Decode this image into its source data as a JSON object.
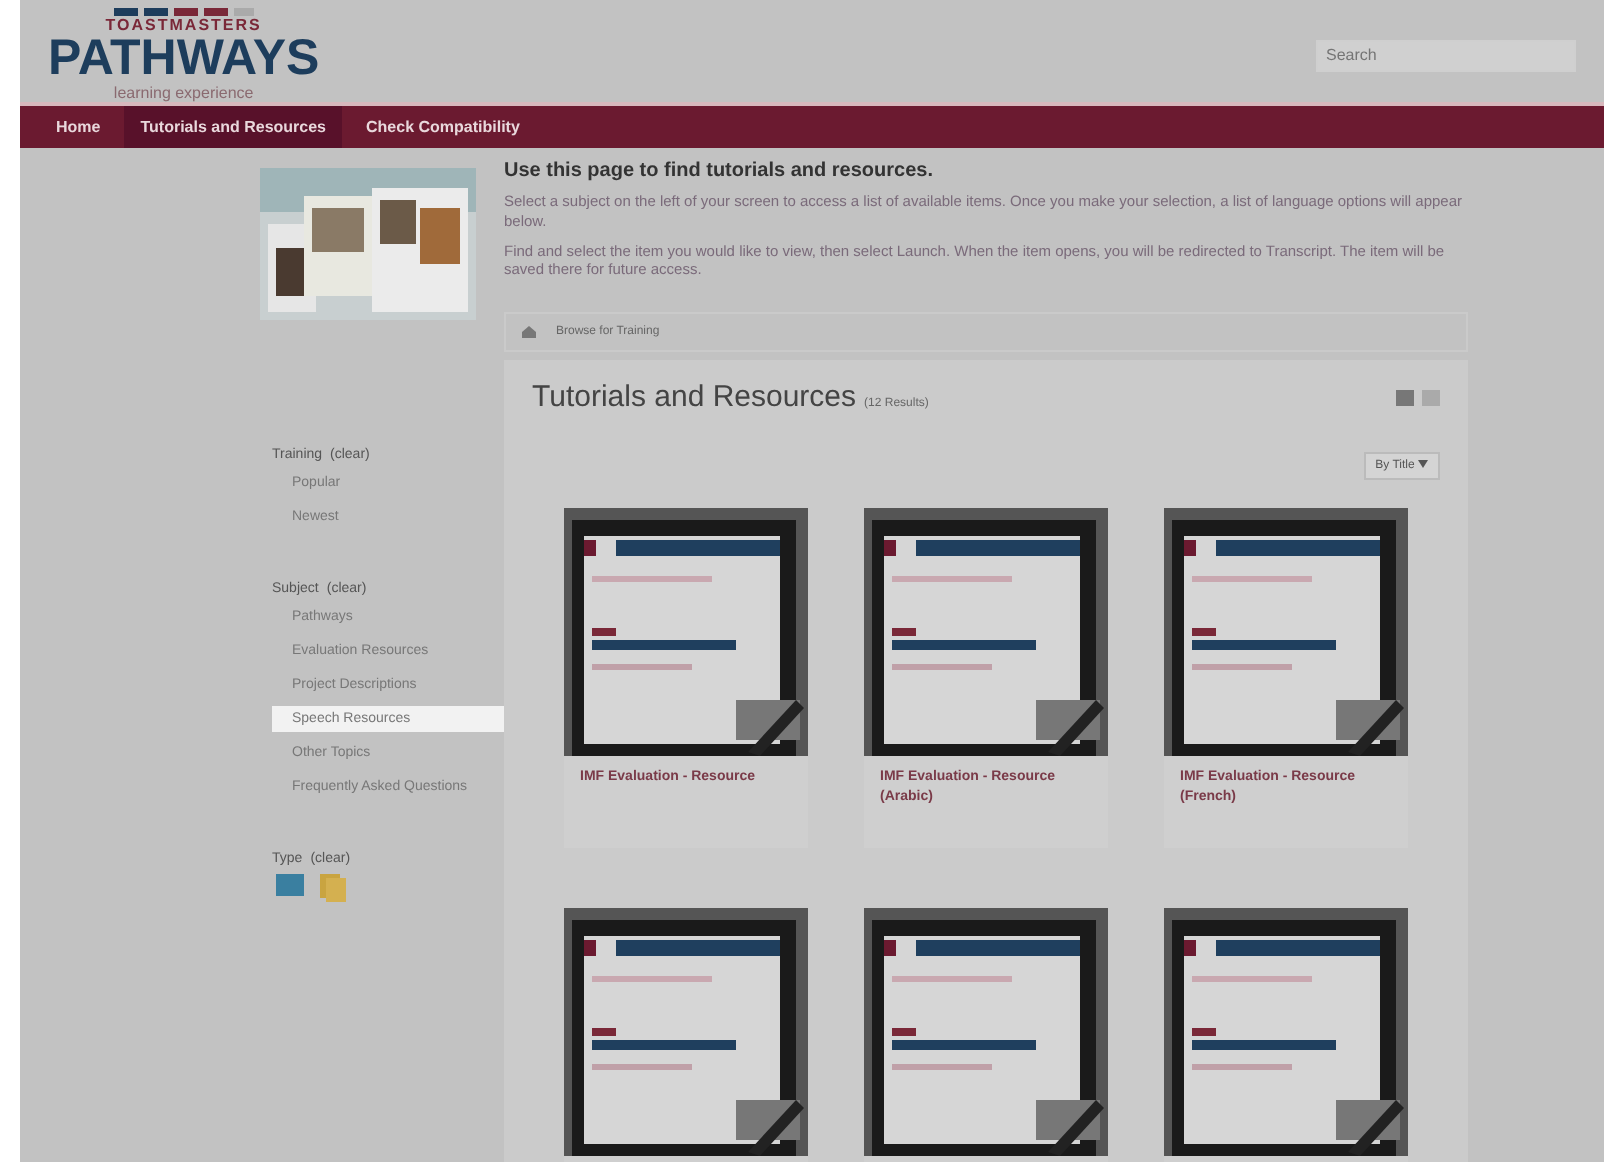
{
  "header": {
    "logo_top": "TOASTMASTERS",
    "logo_main": "PATHWAYS",
    "logo_sub": "learning experience",
    "search": {
      "placeholder": "Search"
    }
  },
  "nav": [
    {
      "label": "Home",
      "selected": false
    },
    {
      "label": "Tutorials and Resources",
      "selected": true
    },
    {
      "label": "Check Compatibility",
      "selected": false
    }
  ],
  "intro": {
    "heading": "Use this page to find tutorials and resources.",
    "paragraphs": [
      "Select a subject on the left of your screen to access a list of available items. Once you make your selection, a list of language options will appear below.",
      "Find and select the item you would like to view, then select Launch. When the item opens, you will be redirected to Transcript. The item will be saved there for future access."
    ]
  },
  "breadcrumb": "Browse for Training",
  "filters": [
    {
      "title": "Training",
      "clear": "(clear)",
      "items": [
        {
          "label": "Popular",
          "selected": false
        },
        {
          "label": "Newest",
          "selected": false
        }
      ]
    },
    {
      "title": "Subject",
      "clear": "(clear)",
      "items": [
        {
          "label": "Pathways",
          "selected": false
        },
        {
          "label": "Evaluation Resources",
          "selected": false
        },
        {
          "label": "Project Descriptions",
          "selected": false
        },
        {
          "label": "Speech Resources",
          "selected": true
        },
        {
          "label": "Other Topics",
          "selected": false
        },
        {
          "label": "Frequently Asked Questions",
          "selected": false
        }
      ]
    },
    {
      "title": "Type",
      "clear": "(clear)",
      "types": [
        {
          "kind": "video"
        },
        {
          "kind": "document"
        }
      ]
    }
  ],
  "results": {
    "title": "Tutorials and Resources",
    "count": "(12 Results)",
    "sort": "By Title",
    "cards": [
      {
        "kind": "titled",
        "title": "IMF Evaluation - Resource"
      },
      {
        "kind": "titled",
        "title": "IMF Evaluation - Resource (Arabic)"
      },
      {
        "kind": "titled",
        "title": "IMF Evaluation - Resource (French)"
      },
      {
        "kind": "image_only"
      },
      {
        "kind": "image_only"
      },
      {
        "kind": "image_only"
      }
    ]
  }
}
